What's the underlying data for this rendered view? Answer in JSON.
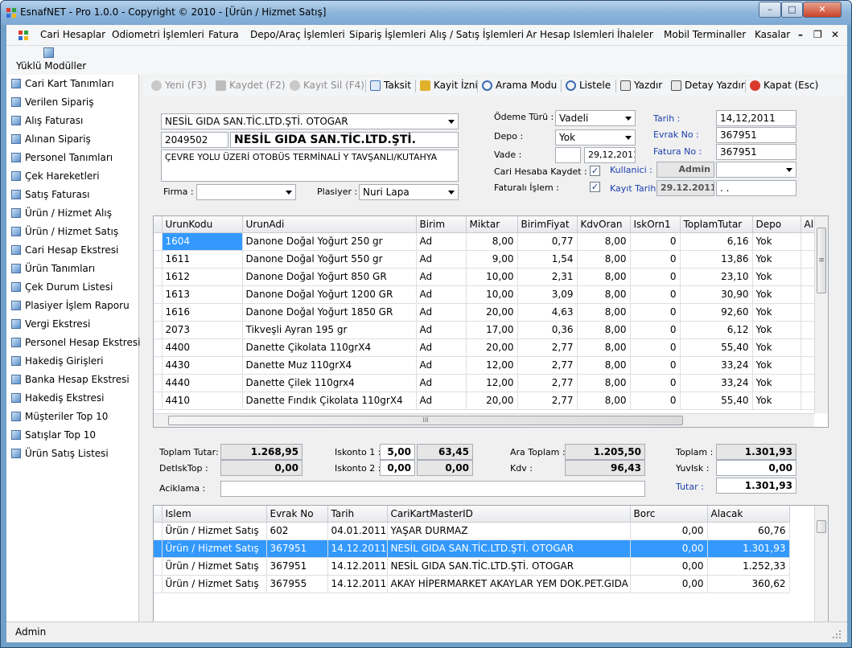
{
  "window": {
    "title": "EsnafNET - Pro 1.0.0 - Copyright ©  2010 - [Ürün / Hizmet Satış]",
    "min": "–",
    "max": "□",
    "close": "✕"
  },
  "menu": [
    "Cari Hesaplar",
    "Odiometri İşlemleri",
    "Fatura",
    "Depo/Araç İşlemleri",
    "Sipariş İşlemleri",
    "Alış / Satış İşlemleri",
    "Ar Hesap Islemleri",
    "İhaleler",
    "Mobil Terminaller",
    "Kasalar"
  ],
  "menu_controls": {
    "min": "–",
    "restore": "❐",
    "close": "✕"
  },
  "modules_label": "Yüklü Modüller",
  "sidebar": [
    "Cari Kart Tanımları",
    "Verilen Sipariş",
    "Alış Faturası",
    "Alınan Sipariş",
    "Personel Tanımları",
    "Çek Hareketleri",
    "Satış Faturası",
    "Ürün / Hizmet Alış",
    "Ürün / Hizmet Satış",
    "Cari Hesap Ekstresi",
    "Ürün Tanımları",
    "Çek Durum Listesi",
    "Plasiyer İşlem Raporu",
    "Vergi Ekstresi",
    "Personel Hesap Ekstresi",
    "Hakediş Girişleri",
    "Banka Hesap Ekstresi",
    "Hakediş Ekstresi",
    "Müşteriler Top 10",
    "Satışlar Top 10",
    "Ürün Satış Listesi"
  ],
  "toolbar": {
    "new": "Yeni (F3)",
    "save": "Kaydet (F2)",
    "delete": "Kayıt Sil (F4)",
    "installment": "Taksit",
    "permission": "Kayit İzni",
    "search_mode": "Arama Modu",
    "list": "Listele",
    "print": "Yazdır",
    "detail_print": "Detay Yazdır",
    "close": "Kapat (Esc)"
  },
  "header": {
    "customer": "NESİL GIDA SAN.TİC.LTD.ŞTİ.  OTOGAR",
    "customer_code": "2049502",
    "customer_name": "NESİL GIDA SAN.TİC.LTD.ŞTİ.",
    "address": "ÇEVRE YOLU ÜZERİ OTOBÜS TERMİNALİ Y TAVŞANLI/KUTAHYA",
    "firma_label": "Firma :",
    "firma": "",
    "plasiyer_label": "Plasiyer :",
    "plasiyer": "Nuri Lapa",
    "payment_label": "Ödeme Türü :",
    "payment": "Vadeli",
    "depot_label": "Depo :",
    "depot": "Yok",
    "due_label": "Vade :",
    "due_days": "",
    "due_date": "29,12,2011",
    "save_to_account_label": "Cari Hesaba Kaydet :",
    "invoiced_label": "Faturalı İşlem :",
    "check_mark": "✓",
    "user_label": "Kullanici :",
    "user": "Admin",
    "record_date_label": "Kayıt Tarihi :",
    "record_date": "29.12.2011",
    "record_time": " .  .",
    "date_label": "Tarih :",
    "date": "14,12,2011",
    "doc_no_label": "Evrak No :",
    "doc_no": "367951",
    "invoice_no_label": "Fatura No :",
    "invoice_no": "367951"
  },
  "items": {
    "columns": [
      "UrunKodu",
      "UrunAdi",
      "Birim",
      "Miktar",
      "BirimFiyat",
      "KdvOran",
      "IskOrn1",
      "ToplamTutar",
      "Depo",
      "Ali"
    ],
    "rows": [
      [
        "1604",
        "Danone Doğal Yoğurt 250 gr",
        "Ad",
        "8,00",
        "0,77",
        "8,00",
        "0",
        "6,16",
        "Yok"
      ],
      [
        "1611",
        "Danone Doğal Yoğurt 550 gr",
        "Ad",
        "9,00",
        "1,54",
        "8,00",
        "0",
        "13,86",
        "Yok"
      ],
      [
        "1612",
        "Danone Doğal Yoğurt 850 GR",
        "Ad",
        "10,00",
        "2,31",
        "8,00",
        "0",
        "23,10",
        "Yok"
      ],
      [
        "1613",
        "Danone Doğal Yoğurt 1200 GR",
        "Ad",
        "10,00",
        "3,09",
        "8,00",
        "0",
        "30,90",
        "Yok"
      ],
      [
        "1616",
        "Danone Doğal Yoğurt 1850 GR",
        "Ad",
        "20,00",
        "4,63",
        "8,00",
        "0",
        "92,60",
        "Yok"
      ],
      [
        "2073",
        "Tikveşli Ayran 195 gr",
        "Ad",
        "17,00",
        "0,36",
        "8,00",
        "0",
        "6,12",
        "Yok"
      ],
      [
        "4400",
        "Danette Çikolata 110grX4",
        "Ad",
        "20,00",
        "2,77",
        "8,00",
        "0",
        "55,40",
        "Yok"
      ],
      [
        "4430",
        "Danette Muz 110grX4",
        "Ad",
        "12,00",
        "2,77",
        "8,00",
        "0",
        "33,24",
        "Yok"
      ],
      [
        "4440",
        "Danette Çilek 110grx4",
        "Ad",
        "12,00",
        "2,77",
        "8,00",
        "0",
        "33,24",
        "Yok"
      ],
      [
        "4410",
        "Danette Fındık Çikolata 110grX4",
        "Ad",
        "20,00",
        "2,77",
        "8,00",
        "0",
        "55,40",
        "Yok"
      ]
    ],
    "scroll_grip": "≡",
    "hscroll_grip": "III"
  },
  "totals": {
    "total_label": "Toplam Tutar:",
    "total": "1.268,95",
    "det_label": "DetIskTop :",
    "det": "0,00",
    "isk1_label": "Iskonto 1 :",
    "isk1": "5,00",
    "isk1_amount": "63,45",
    "isk2_label": "Iskonto 2 :",
    "isk2": "0,00",
    "isk2_amount": "0,00",
    "subtotal_label": "Ara Toplam :",
    "subtotal": "1.205,50",
    "kdv_label": "Kdv :",
    "kdv": "96,43",
    "grand_label": "Toplam :",
    "grand": "1.301,93",
    "round_label": "YuvIsk :",
    "round": "0,00",
    "amount_label": "Tutar :",
    "amount": "1.301,93",
    "note_label": "Aciklama :",
    "note": ""
  },
  "history": {
    "columns": [
      "Islem",
      "Evrak No",
      "Tarih",
      "CariKartMasterID",
      "Borc",
      "Alacak"
    ],
    "rows": [
      [
        "Ürün / Hizmet Satış",
        "602",
        "04.01.2011",
        "YAŞAR DURMAZ",
        "0,00",
        "60,76"
      ],
      [
        "Ürün / Hizmet Satış",
        "367951",
        "14.12.2011",
        "NESİL GIDA SAN.TİC.LTD.ŞTİ.  OTOGAR",
        "0,00",
        "1.301,93"
      ],
      [
        "Ürün / Hizmet Satış",
        "367951",
        "14.12.2011",
        "NESİL GIDA SAN.TİC.LTD.ŞTİ.  OTOGAR",
        "0,00",
        "1.252,33"
      ],
      [
        "Ürün / Hizmet Satış",
        "367955",
        "14.12.2011",
        "AKAY HİPERMARKET AKAYLAR YEM DOK.PET.GIDA S...",
        "0,00",
        "360,62"
      ]
    ]
  },
  "status": {
    "user": "Admin"
  }
}
